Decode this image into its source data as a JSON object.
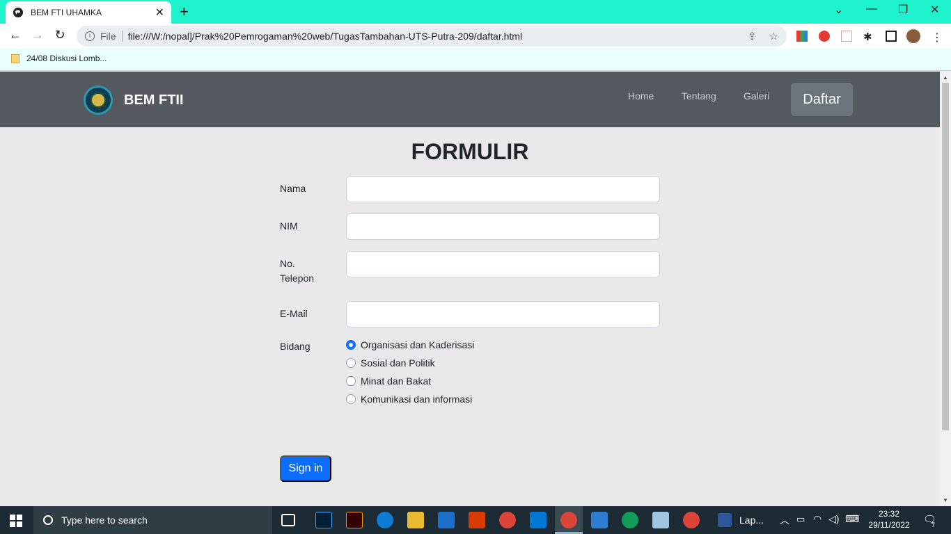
{
  "browser": {
    "tab_title": "BEM FTI UHAMKA",
    "new_tab": "+",
    "url_scheme_label": "File",
    "url": "file:///W:/nopal]/Prak%20Pemrogaman%20web/TugasTambahan-UTS-Putra-209/daftar.html",
    "bookmark": "24/08 Diskusi Lomb...",
    "back_icon": "arrow-left",
    "forward_icon": "arrow-right",
    "reload_icon": "reload"
  },
  "navbar": {
    "brand": "BEM FTII",
    "links": [
      "Home",
      "Tentang",
      "Galeri"
    ],
    "cta": "Daftar"
  },
  "form": {
    "title": "FORMULIR",
    "fields": [
      {
        "label": "Nama",
        "value": ""
      },
      {
        "label": "NIM",
        "value": ""
      },
      {
        "label": "No. Telepon",
        "value": ""
      },
      {
        "label": "E-Mail",
        "value": ""
      }
    ],
    "bidang_label": "Bidang",
    "bidang_options": [
      {
        "label": "Organisasi dan Kaderisasi",
        "checked": true
      },
      {
        "label": "Sosial dan Politik",
        "checked": false
      },
      {
        "label": "Minat dan Bakat",
        "checked": false
      },
      {
        "label": "Komunikasi dan informasi",
        "checked": false
      }
    ],
    "submit": "Sign in"
  },
  "taskbar": {
    "search_placeholder": "Type here to search",
    "app_label": "Lap...",
    "time": "23:32",
    "date": "29/11/2022",
    "notification_count": "7"
  },
  "colors": {
    "accent": "#0d6efd",
    "navbar": "#54595f",
    "tab_strip": "#1df2cc"
  }
}
